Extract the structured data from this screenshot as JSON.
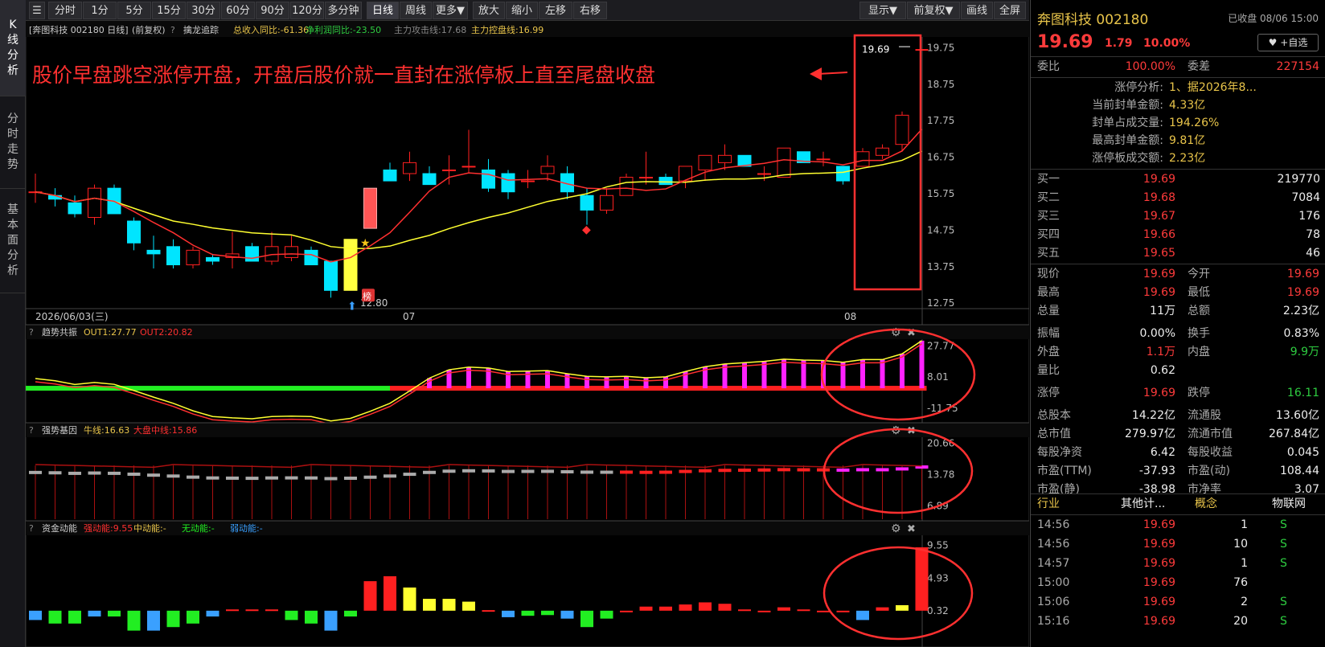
{
  "sidebar": {
    "tabs": [
      "K线分析",
      "分时走势",
      "基本面分析"
    ]
  },
  "toolbar": {
    "left": [
      "分时",
      "1分",
      "5分",
      "15分",
      "30分",
      "60分",
      "90分",
      "120分",
      "多分钟",
      "日线",
      "周线",
      "更多▼",
      "放大",
      "缩小",
      "左移",
      "右移"
    ],
    "right": [
      "显示▼",
      "前复权▼",
      "画线",
      "全屏"
    ],
    "active": "日线"
  },
  "main_panel": {
    "header": {
      "stock": "[奔图科技 002180 日线]",
      "adjust": "(前复权)",
      "help": "?",
      "indicator": "擒龙追踪",
      "f1": "总收入同比:-61.36",
      "f2": "净利润同比:-23.50",
      "f3": "主力攻击线:17.68",
      "f4": "主力控盘线:16.99"
    },
    "annotation": "股价早盘跳空涨停开盘，开盘后股价就一直封在涨停板上直至尾盘收盘",
    "price_labels": [
      "19.75",
      "18.75",
      "17.75",
      "16.75",
      "15.75",
      "14.75",
      "13.75",
      "12.75"
    ],
    "last_price_label": "19.69",
    "low_label": "12.80",
    "bang_label": "榜",
    "date_labels": [
      "2026/06/03(三)",
      "07",
      "08"
    ]
  },
  "sub1": {
    "name": "趋势共振",
    "out1": "OUT1:27.77",
    "out2": "OUT2:20.82",
    "labels": [
      "27.77",
      "8.01",
      "-11.75"
    ]
  },
  "sub2": {
    "name": "强势基因",
    "niu": "牛线:16.63",
    "dapan": "大盘中线:15.86",
    "labels": [
      "20.66",
      "13.78",
      "6.89"
    ]
  },
  "sub3": {
    "name": "资金动能",
    "strong": "强动能:9.55",
    "mid": "中动能:-",
    "none": "无动能:-",
    "weak": "弱动能:-",
    "labels": [
      "9.55",
      "4.93",
      "0.32"
    ]
  },
  "quote": {
    "title": "奔图科技 002180",
    "status": "已收盘 08/06 15:00",
    "price": "19.69",
    "change": "1.79",
    "pct": "10.00%",
    "fav": "+自选",
    "weibi_label": "委比",
    "weibi": "100.00%",
    "weicha_label": "委差",
    "weicha": "227154",
    "limit_info": [
      {
        "k": "涨停分析:",
        "v": "1、据2026年8..."
      },
      {
        "k": "当前封单金额:",
        "v": "4.33亿"
      },
      {
        "k": "封单占成交量:",
        "v": "194.26%"
      },
      {
        "k": "最高封单金额:",
        "v": "9.81亿"
      },
      {
        "k": "涨停板成交额:",
        "v": "2.23亿"
      }
    ],
    "bids": [
      {
        "k": "买一",
        "p": "19.69",
        "v": "219770"
      },
      {
        "k": "买二",
        "p": "19.68",
        "v": "7084"
      },
      {
        "k": "买三",
        "p": "19.67",
        "v": "176"
      },
      {
        "k": "买四",
        "p": "19.66",
        "v": "78"
      },
      {
        "k": "买五",
        "p": "19.65",
        "v": "46"
      }
    ],
    "stats": [
      {
        "a": "现价",
        "b": "19.69",
        "c": "今开",
        "d": "19.69"
      },
      {
        "a": "最高",
        "b": "19.69",
        "c": "最低",
        "d": "19.69"
      },
      {
        "a": "总量",
        "b": "11万",
        "c": "总额",
        "d": "2.23亿"
      },
      {
        "a": "振幅",
        "b": "0.00%",
        "c": "换手",
        "d": "0.83%"
      },
      {
        "a": "外盘",
        "b": "1.1万",
        "c": "内盘",
        "d": "9.9万"
      },
      {
        "a": "量比",
        "b": "0.62",
        "c": "",
        "d": ""
      },
      {
        "a": "涨停",
        "b": "19.69",
        "c": "跌停",
        "d": "16.11"
      },
      {
        "a": "总股本",
        "b": "14.22亿",
        "c": "流通股",
        "d": "13.60亿"
      },
      {
        "a": "总市值",
        "b": "279.97亿",
        "c": "流通市值",
        "d": "267.84亿"
      },
      {
        "a": "每股净资",
        "b": "6.42",
        "c": "每股收益",
        "d": "0.045"
      },
      {
        "a": "市盈(TTM)",
        "b": "-37.93",
        "c": "市盈(动)",
        "d": "108.44"
      },
      {
        "a": "市盈(静)",
        "b": "-38.98",
        "c": "市净率",
        "d": "3.07"
      }
    ],
    "industry": {
      "a": "行业",
      "b": "其他计...",
      "c": "概念",
      "d": "物联网"
    },
    "ticks": [
      {
        "t": "14:56",
        "p": "19.69",
        "v": "1",
        "s": "S"
      },
      {
        "t": "14:56",
        "p": "19.69",
        "v": "10",
        "s": "S"
      },
      {
        "t": "14:57",
        "p": "19.69",
        "v": "1",
        "s": "S"
      },
      {
        "t": "15:00",
        "p": "19.69",
        "v": "76",
        "s": ""
      },
      {
        "t": "15:06",
        "p": "19.69",
        "v": "2",
        "s": "S"
      },
      {
        "t": "15:16",
        "p": "19.69",
        "v": "20",
        "s": "S"
      }
    ]
  },
  "candles": [
    {
      "o": 15.8,
      "h": 16.3,
      "l": 15.5,
      "c": 15.8
    },
    {
      "o": 15.7,
      "h": 15.9,
      "l": 15.4,
      "c": 15.6
    },
    {
      "o": 15.5,
      "h": 15.7,
      "l": 15.1,
      "c": 15.2
    },
    {
      "o": 15.1,
      "h": 16.0,
      "l": 14.9,
      "c": 15.9
    },
    {
      "o": 15.9,
      "h": 16.0,
      "l": 15.2,
      "c": 15.2
    },
    {
      "o": 15.0,
      "h": 15.1,
      "l": 14.2,
      "c": 14.4
    },
    {
      "o": 14.2,
      "h": 14.6,
      "l": 13.7,
      "c": 14.1
    },
    {
      "o": 14.3,
      "h": 14.5,
      "l": 13.7,
      "c": 13.8
    },
    {
      "o": 13.8,
      "h": 14.3,
      "l": 13.7,
      "c": 14.2
    },
    {
      "o": 14.0,
      "h": 14.1,
      "l": 13.8,
      "c": 13.9
    },
    {
      "o": 14.0,
      "h": 14.7,
      "l": 13.7,
      "c": 14.1
    },
    {
      "o": 14.3,
      "h": 14.4,
      "l": 13.9,
      "c": 13.9
    },
    {
      "o": 13.9,
      "h": 14.7,
      "l": 13.8,
      "c": 14.3
    },
    {
      "o": 14.0,
      "h": 14.6,
      "l": 13.9,
      "c": 14.3
    },
    {
      "o": 14.2,
      "h": 14.3,
      "l": 13.8,
      "c": 13.8
    },
    {
      "o": 13.9,
      "h": 13.9,
      "l": 12.9,
      "c": 13.1
    },
    {
      "o": 13.1,
      "h": 14.5,
      "l": 13.1,
      "c": 14.5
    },
    {
      "o": 14.8,
      "h": 15.9,
      "l": 14.8,
      "c": 15.9
    },
    {
      "o": 16.4,
      "h": 16.6,
      "l": 16.1,
      "c": 16.1
    },
    {
      "o": 16.3,
      "h": 16.9,
      "l": 16.1,
      "c": 16.6
    },
    {
      "o": 16.3,
      "h": 16.5,
      "l": 16.0,
      "c": 16.0
    },
    {
      "o": 16.4,
      "h": 16.8,
      "l": 16.0,
      "c": 16.4
    },
    {
      "o": 16.5,
      "h": 17.5,
      "l": 16.3,
      "c": 16.5
    },
    {
      "o": 16.4,
      "h": 16.7,
      "l": 15.8,
      "c": 15.9
    },
    {
      "o": 16.3,
      "h": 16.4,
      "l": 15.6,
      "c": 15.8
    },
    {
      "o": 16.1,
      "h": 16.4,
      "l": 15.9,
      "c": 16.1
    },
    {
      "o": 16.3,
      "h": 16.8,
      "l": 16.1,
      "c": 16.5
    },
    {
      "o": 16.3,
      "h": 16.5,
      "l": 15.6,
      "c": 15.8
    },
    {
      "o": 15.7,
      "h": 15.9,
      "l": 14.9,
      "c": 15.3
    },
    {
      "o": 15.3,
      "h": 15.9,
      "l": 15.2,
      "c": 15.7
    },
    {
      "o": 15.7,
      "h": 16.3,
      "l": 15.7,
      "c": 16.2
    },
    {
      "o": 16.2,
      "h": 16.9,
      "l": 16.0,
      "c": 16.2
    },
    {
      "o": 16.2,
      "h": 16.3,
      "l": 16.0,
      "c": 16.0
    },
    {
      "o": 16.1,
      "h": 16.5,
      "l": 15.9,
      "c": 16.5
    },
    {
      "o": 16.4,
      "h": 16.8,
      "l": 16.1,
      "c": 16.8
    },
    {
      "o": 16.6,
      "h": 17.1,
      "l": 16.4,
      "c": 16.8
    },
    {
      "o": 16.8,
      "h": 16.8,
      "l": 16.5,
      "c": 16.5
    },
    {
      "o": 16.3,
      "h": 16.5,
      "l": 16.1,
      "c": 16.3
    },
    {
      "o": 16.2,
      "h": 17.0,
      "l": 16.2,
      "c": 17.0
    },
    {
      "o": 16.9,
      "h": 16.9,
      "l": 16.6,
      "c": 16.6
    },
    {
      "o": 16.7,
      "h": 16.9,
      "l": 16.5,
      "c": 16.7
    },
    {
      "o": 16.5,
      "h": 16.5,
      "l": 16.0,
      "c": 16.1
    },
    {
      "o": 16.5,
      "h": 17.0,
      "l": 16.5,
      "c": 16.9
    },
    {
      "o": 16.8,
      "h": 17.1,
      "l": 16.7,
      "c": 17.0
    },
    {
      "o": 17.1,
      "h": 18.0,
      "l": 16.9,
      "c": 17.9
    },
    {
      "o": 19.69,
      "h": 19.69,
      "l": 19.69,
      "c": 19.69
    }
  ]
}
